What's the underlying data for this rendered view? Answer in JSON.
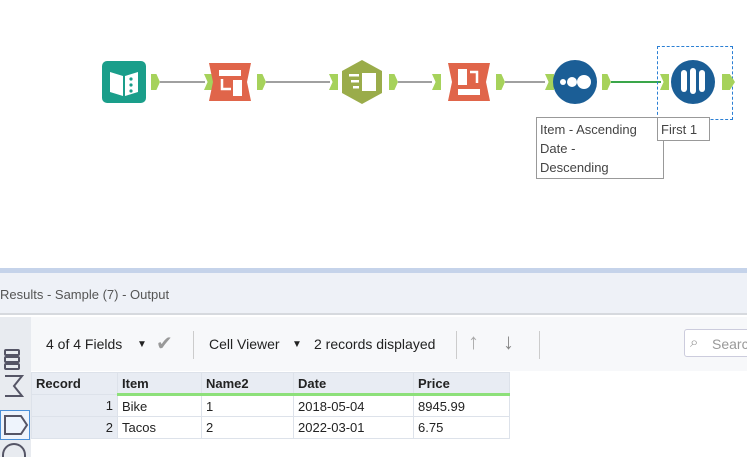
{
  "workflow": {
    "tools": [
      {
        "name": "input-data",
        "color": "#1a9e8a"
      },
      {
        "name": "select",
        "color": "#e0654a"
      },
      {
        "name": "formula",
        "color": "#9aac4a"
      },
      {
        "name": "transpose",
        "color": "#e0654a"
      },
      {
        "name": "sort",
        "color": "#1b5e96"
      },
      {
        "name": "sample",
        "color": "#1b5e96"
      }
    ],
    "sort_annotation": [
      "Item - Ascending",
      "Date -",
      "Descending"
    ],
    "sample_annotation": "First 1"
  },
  "results": {
    "title": "Results - Sample (7) - Output",
    "fields_label": "4 of 4 Fields",
    "cell_viewer_label": "Cell Viewer",
    "records_displayed": "2 records displayed",
    "search_placeholder": "Search",
    "columns": [
      "Record",
      "Item",
      "Name2",
      "Date",
      "Price"
    ],
    "rows": [
      [
        "1",
        "Bike",
        "1",
        "2018-05-04",
        "8945.99"
      ],
      [
        "2",
        "Tacos",
        "2",
        "2022-03-01",
        "6.75"
      ]
    ]
  }
}
